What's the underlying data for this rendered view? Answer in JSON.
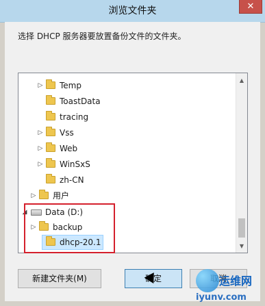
{
  "window": {
    "title": "浏览文件夹",
    "close_glyph": "✕"
  },
  "instruction": "选择 DHCP 服务器要放置备份文件的文件夹。",
  "tree": {
    "items": [
      {
        "label": "Temp",
        "expander": "▷",
        "icon": "folder-icon"
      },
      {
        "label": "ToastData",
        "expander": "",
        "icon": "folder-icon"
      },
      {
        "label": "tracing",
        "expander": "",
        "icon": "folder-icon"
      },
      {
        "label": "Vss",
        "expander": "▷",
        "icon": "folder-icon"
      },
      {
        "label": "Web",
        "expander": "▷",
        "icon": "folder-icon"
      },
      {
        "label": "WinSxS",
        "expander": "▷",
        "icon": "folder-icon"
      },
      {
        "label": "zh-CN",
        "expander": "",
        "icon": "folder-icon"
      },
      {
        "label": "用户",
        "expander": "▷",
        "icon": "folder-icon"
      },
      {
        "label": "Data (D:)",
        "expander": "◢",
        "icon": "drive-icon"
      },
      {
        "label": "backup",
        "expander": "▷",
        "icon": "folder-icon"
      },
      {
        "label": "dhcp-20.1",
        "expander": "",
        "icon": "folder-icon",
        "selected": true
      }
    ],
    "scroll_up": "▲",
    "scroll_down": "▼"
  },
  "buttons": {
    "new_folder": "新建文件夹(M)",
    "ok": "确定",
    "cancel": "取消"
  },
  "watermark": {
    "brand": "运维网",
    "url": "iyunv.com"
  },
  "colors": {
    "titlebar": "#b7d7ec",
    "highlight_border": "#d4202c",
    "selection": "#cce8ff"
  }
}
